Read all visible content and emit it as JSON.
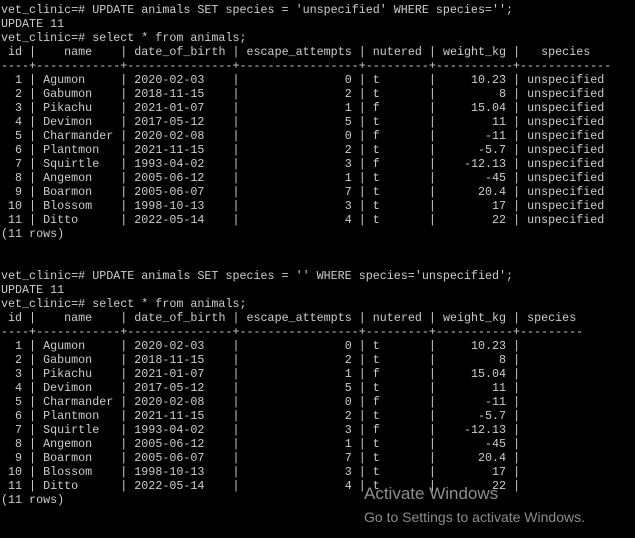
{
  "terminal": {
    "prompt": "vet_clinic=# ",
    "blocks": [
      {
        "command1": "UPDATE animals SET species = 'unspecified' WHERE species='';",
        "result1": "UPDATE 11",
        "command2": "select * from animals;",
        "footer": "(11 rows)",
        "table": {
          "headers": [
            "id",
            "name",
            "date_of_birth",
            "escape_attempts",
            "nutered",
            "weight_kg",
            "species"
          ],
          "numeric": [
            true,
            false,
            false,
            true,
            false,
            true,
            false
          ],
          "rows": [
            [
              "1",
              "Agumon",
              "2020-02-03",
              "0",
              "t",
              "10.23",
              "unspecified"
            ],
            [
              "2",
              "Gabumon",
              "2018-11-15",
              "2",
              "t",
              "8",
              "unspecified"
            ],
            [
              "3",
              "Pikachu",
              "2021-01-07",
              "1",
              "f",
              "15.04",
              "unspecified"
            ],
            [
              "4",
              "Devimon",
              "2017-05-12",
              "5",
              "t",
              "11",
              "unspecified"
            ],
            [
              "5",
              "Charmander",
              "2020-02-08",
              "0",
              "f",
              "-11",
              "unspecified"
            ],
            [
              "6",
              "Plantmon",
              "2021-11-15",
              "2",
              "t",
              "-5.7",
              "unspecified"
            ],
            [
              "7",
              "Squirtle",
              "1993-04-02",
              "3",
              "f",
              "-12.13",
              "unspecified"
            ],
            [
              "8",
              "Angemon",
              "2005-06-12",
              "1",
              "t",
              "-45",
              "unspecified"
            ],
            [
              "9",
              "Boarmon",
              "2005-06-07",
              "7",
              "t",
              "20.4",
              "unspecified"
            ],
            [
              "10",
              "Blossom",
              "1998-10-13",
              "3",
              "t",
              "17",
              "unspecified"
            ],
            [
              "11",
              "Ditto",
              "2022-05-14",
              "4",
              "t",
              "22",
              "unspecified"
            ]
          ]
        }
      },
      {
        "command1": "UPDATE animals SET species = '' WHERE species='unspecified';",
        "result1": "UPDATE 11",
        "command2": "select * from animals;",
        "footer": "(11 rows)",
        "table": {
          "headers": [
            "id",
            "name",
            "date_of_birth",
            "escape_attempts",
            "nutered",
            "weight_kg",
            "species"
          ],
          "numeric": [
            true,
            false,
            false,
            true,
            false,
            true,
            false
          ],
          "rows": [
            [
              "1",
              "Agumon",
              "2020-02-03",
              "0",
              "t",
              "10.23",
              ""
            ],
            [
              "2",
              "Gabumon",
              "2018-11-15",
              "2",
              "t",
              "8",
              ""
            ],
            [
              "3",
              "Pikachu",
              "2021-01-07",
              "1",
              "f",
              "15.04",
              ""
            ],
            [
              "4",
              "Devimon",
              "2017-05-12",
              "5",
              "t",
              "11",
              ""
            ],
            [
              "5",
              "Charmander",
              "2020-02-08",
              "0",
              "f",
              "-11",
              ""
            ],
            [
              "6",
              "Plantmon",
              "2021-11-15",
              "2",
              "t",
              "-5.7",
              ""
            ],
            [
              "7",
              "Squirtle",
              "1993-04-02",
              "3",
              "f",
              "-12.13",
              ""
            ],
            [
              "8",
              "Angemon",
              "2005-06-12",
              "1",
              "t",
              "-45",
              ""
            ],
            [
              "9",
              "Boarmon",
              "2005-06-07",
              "7",
              "t",
              "20.4",
              ""
            ],
            [
              "10",
              "Blossom",
              "1998-10-13",
              "3",
              "t",
              "17",
              ""
            ],
            [
              "11",
              "Ditto",
              "2022-05-14",
              "4",
              "t",
              "22",
              ""
            ]
          ]
        }
      }
    ]
  },
  "watermark": {
    "title": "Activate Windows",
    "subtitle": "Go to Settings to activate Windows."
  }
}
